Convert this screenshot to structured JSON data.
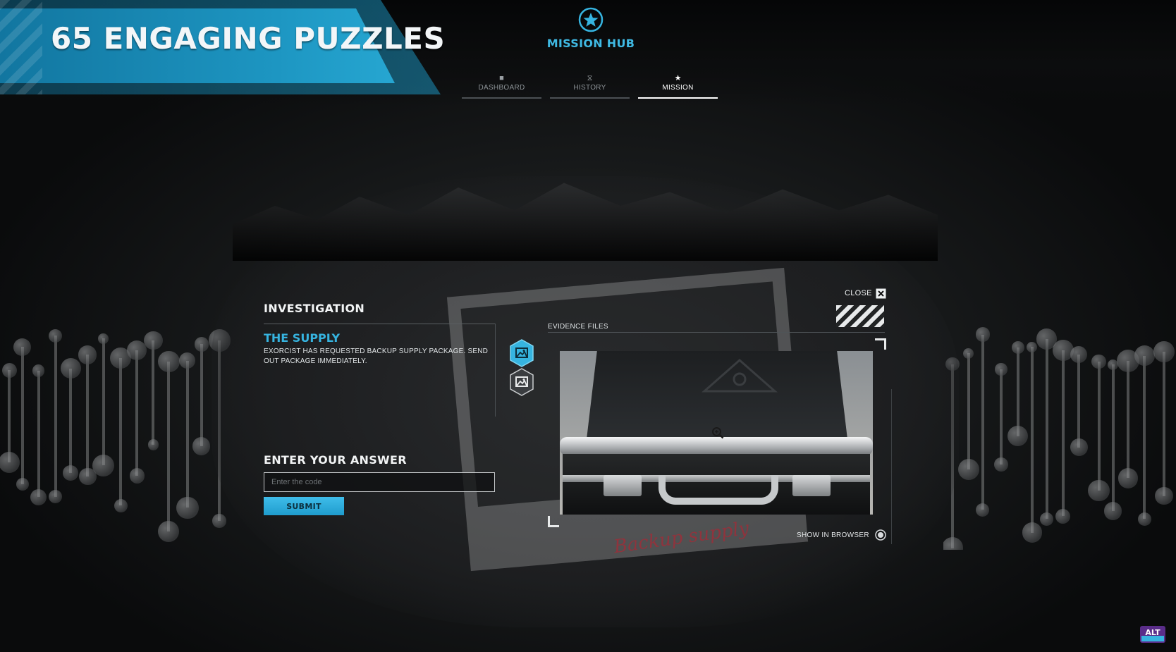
{
  "banner": {
    "title": "65 ENGAGING PUZZLES"
  },
  "header": {
    "hub_label": "MISSION HUB",
    "hub_icon": "star-circle-icon"
  },
  "tabs": [
    {
      "label": "DASHBOARD",
      "icon": "square-icon",
      "glyph": "■",
      "active": false
    },
    {
      "label": "HISTORY",
      "icon": "history-icon",
      "glyph": "⧖",
      "active": false
    },
    {
      "label": "MISSION",
      "icon": "star-icon",
      "glyph": "★",
      "active": true
    }
  ],
  "investigation": {
    "title": "INVESTIGATION",
    "mission_name": "THE SUPPLY",
    "description": "EXORCIST HAS REQUESTED BACKUP SUPPLY PACKAGE. SEND OUT PACKAGE IMMEDIATELY."
  },
  "answer": {
    "title": "ENTER YOUR ANSWER",
    "placeholder": "Enter the code",
    "value": "",
    "submit_label": "SUBMIT"
  },
  "evidence": {
    "label": "EVIDENCE FILES",
    "close_label": "CLOSE",
    "caption": "Backup supply",
    "show_in_browser_label": "SHOW IN BROWSER",
    "thumbnails": [
      {
        "icon": "image-icon",
        "selected": true
      },
      {
        "icon": "image-icon",
        "selected": false
      }
    ]
  },
  "colors": {
    "accent": "#36b4e0",
    "banner": "#1d96c2",
    "caption_red": "#9a2f3a"
  },
  "branding": {
    "logo_text": "ALT"
  }
}
